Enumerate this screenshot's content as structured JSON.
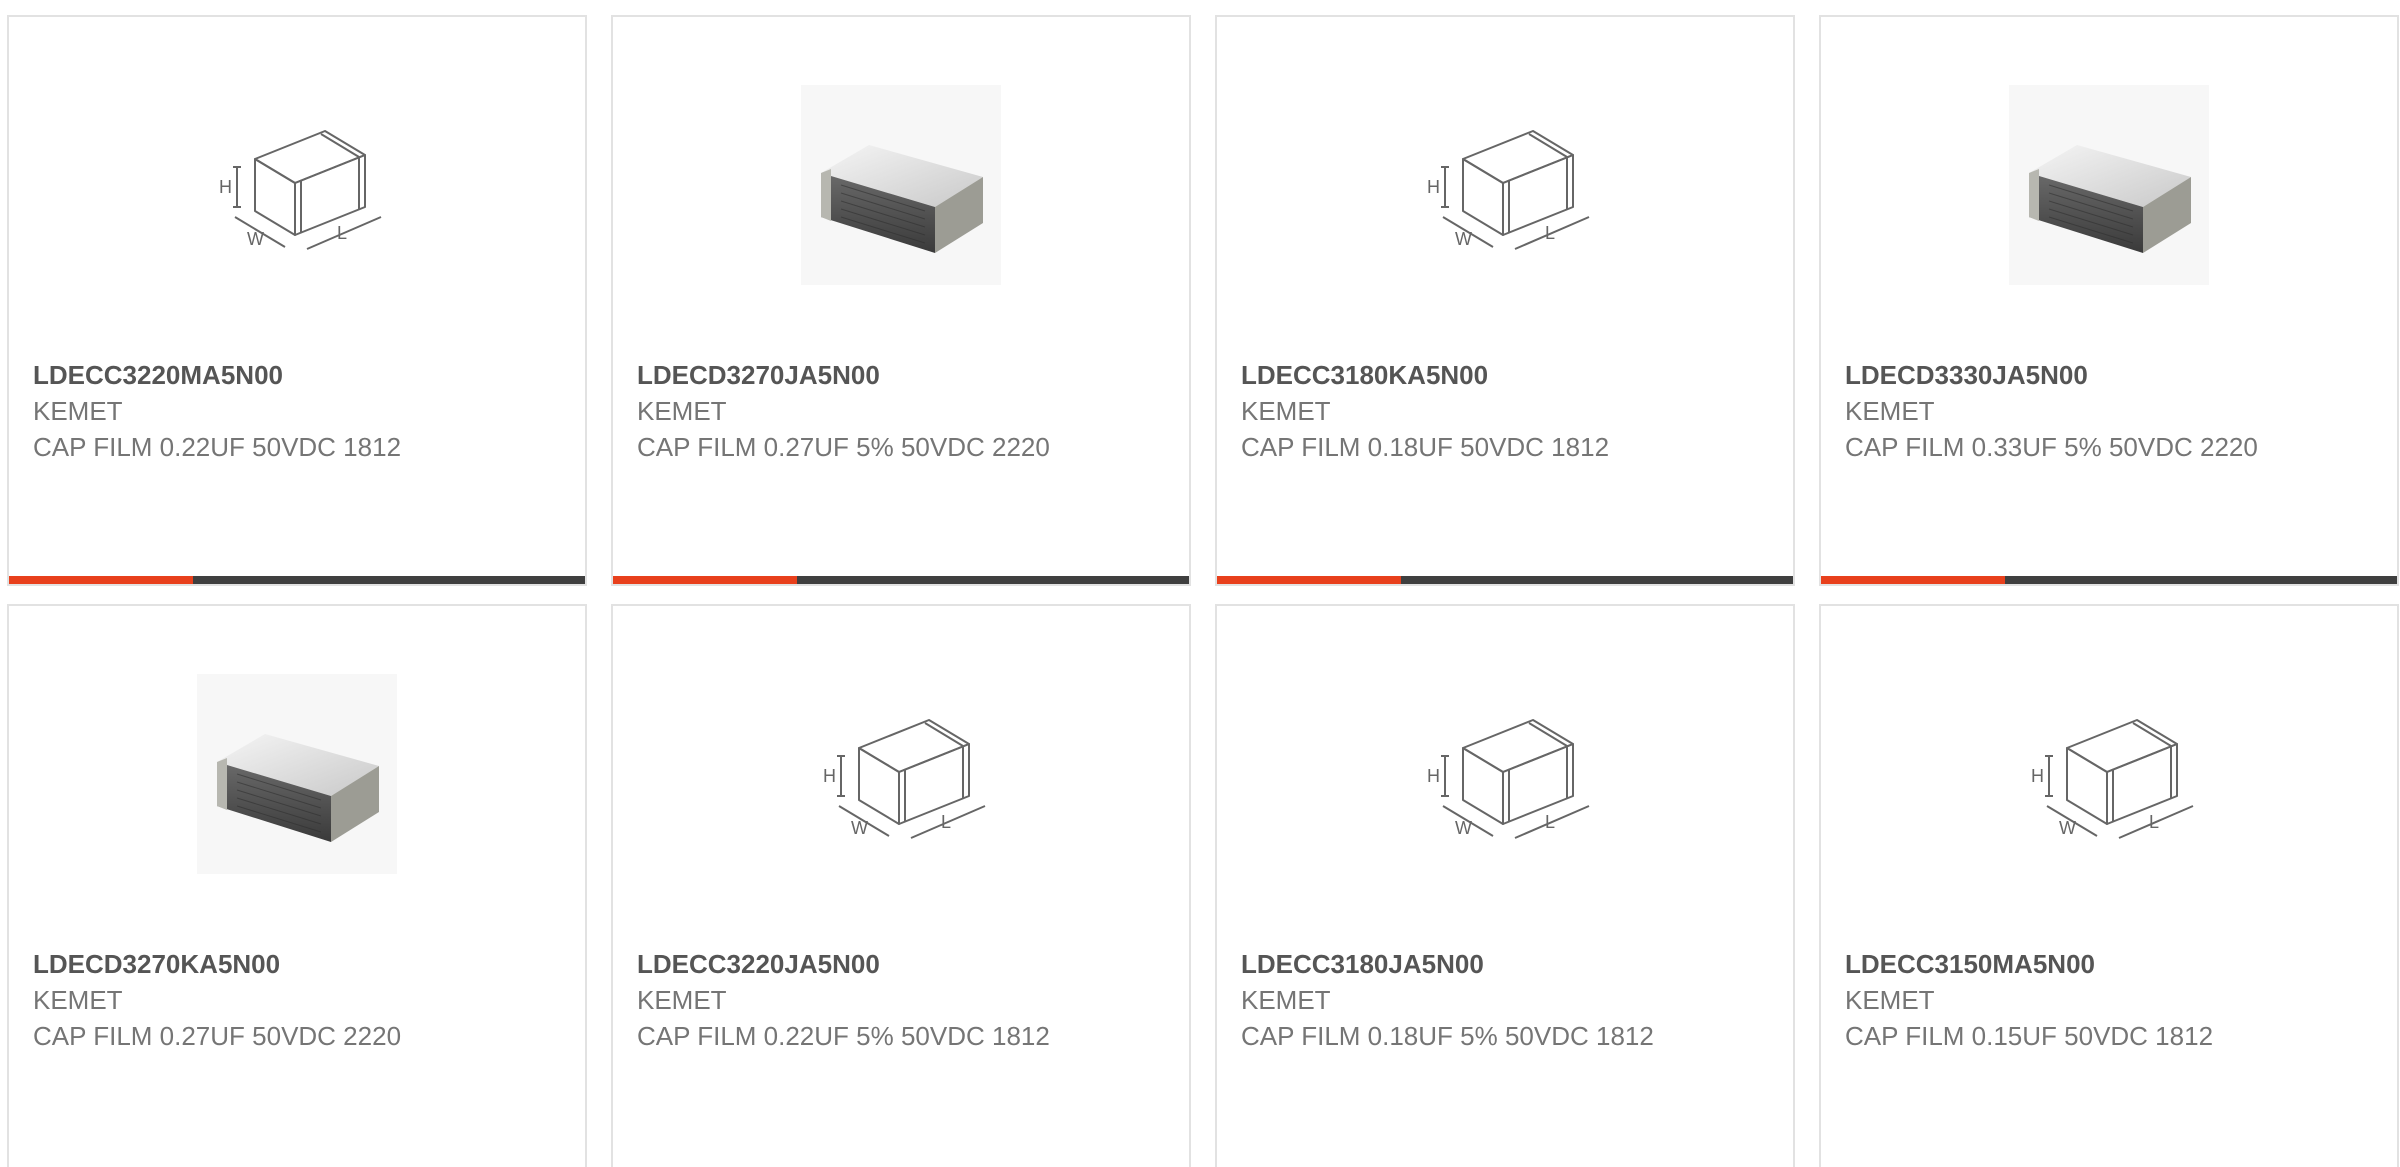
{
  "colors": {
    "accent": "#e8401c",
    "track": "#3f3f3f",
    "border": "#e2e2e2",
    "title_text": "#555555",
    "body_text": "#757575"
  },
  "cards": [
    {
      "part_number": "LDECC3220MA5N00",
      "manufacturer": "KEMET",
      "description": "CAP FILM 0.22UF 50VDC 1812",
      "image": "dimension-diagram-icon",
      "progress_fraction": 0.32
    },
    {
      "part_number": "LDECD3270JA5N00",
      "manufacturer": "KEMET",
      "description": "CAP FILM 0.27UF 5% 50VDC 2220",
      "image": "capacitor-photo-icon",
      "progress_fraction": 0.32
    },
    {
      "part_number": "LDECC3180KA5N00",
      "manufacturer": "KEMET",
      "description": "CAP FILM 0.18UF 50VDC 1812",
      "image": "dimension-diagram-icon",
      "progress_fraction": 0.32
    },
    {
      "part_number": "LDECD3330JA5N00",
      "manufacturer": "KEMET",
      "description": "CAP FILM 0.33UF 5% 50VDC 2220",
      "image": "capacitor-photo-icon",
      "progress_fraction": 0.32
    },
    {
      "part_number": "LDECD3270KA5N00",
      "manufacturer": "KEMET",
      "description": "CAP FILM 0.27UF 50VDC 2220",
      "image": "capacitor-photo-icon"
    },
    {
      "part_number": "LDECC3220JA5N00",
      "manufacturer": "KEMET",
      "description": "CAP FILM 0.22UF 5% 50VDC 1812",
      "image": "dimension-diagram-icon"
    },
    {
      "part_number": "LDECC3180JA5N00",
      "manufacturer": "KEMET",
      "description": "CAP FILM 0.18UF 5% 50VDC 1812",
      "image": "dimension-diagram-icon"
    },
    {
      "part_number": "LDECC3150MA5N00",
      "manufacturer": "KEMET",
      "description": "CAP FILM 0.15UF 50VDC 1812",
      "image": "dimension-diagram-icon"
    }
  ]
}
